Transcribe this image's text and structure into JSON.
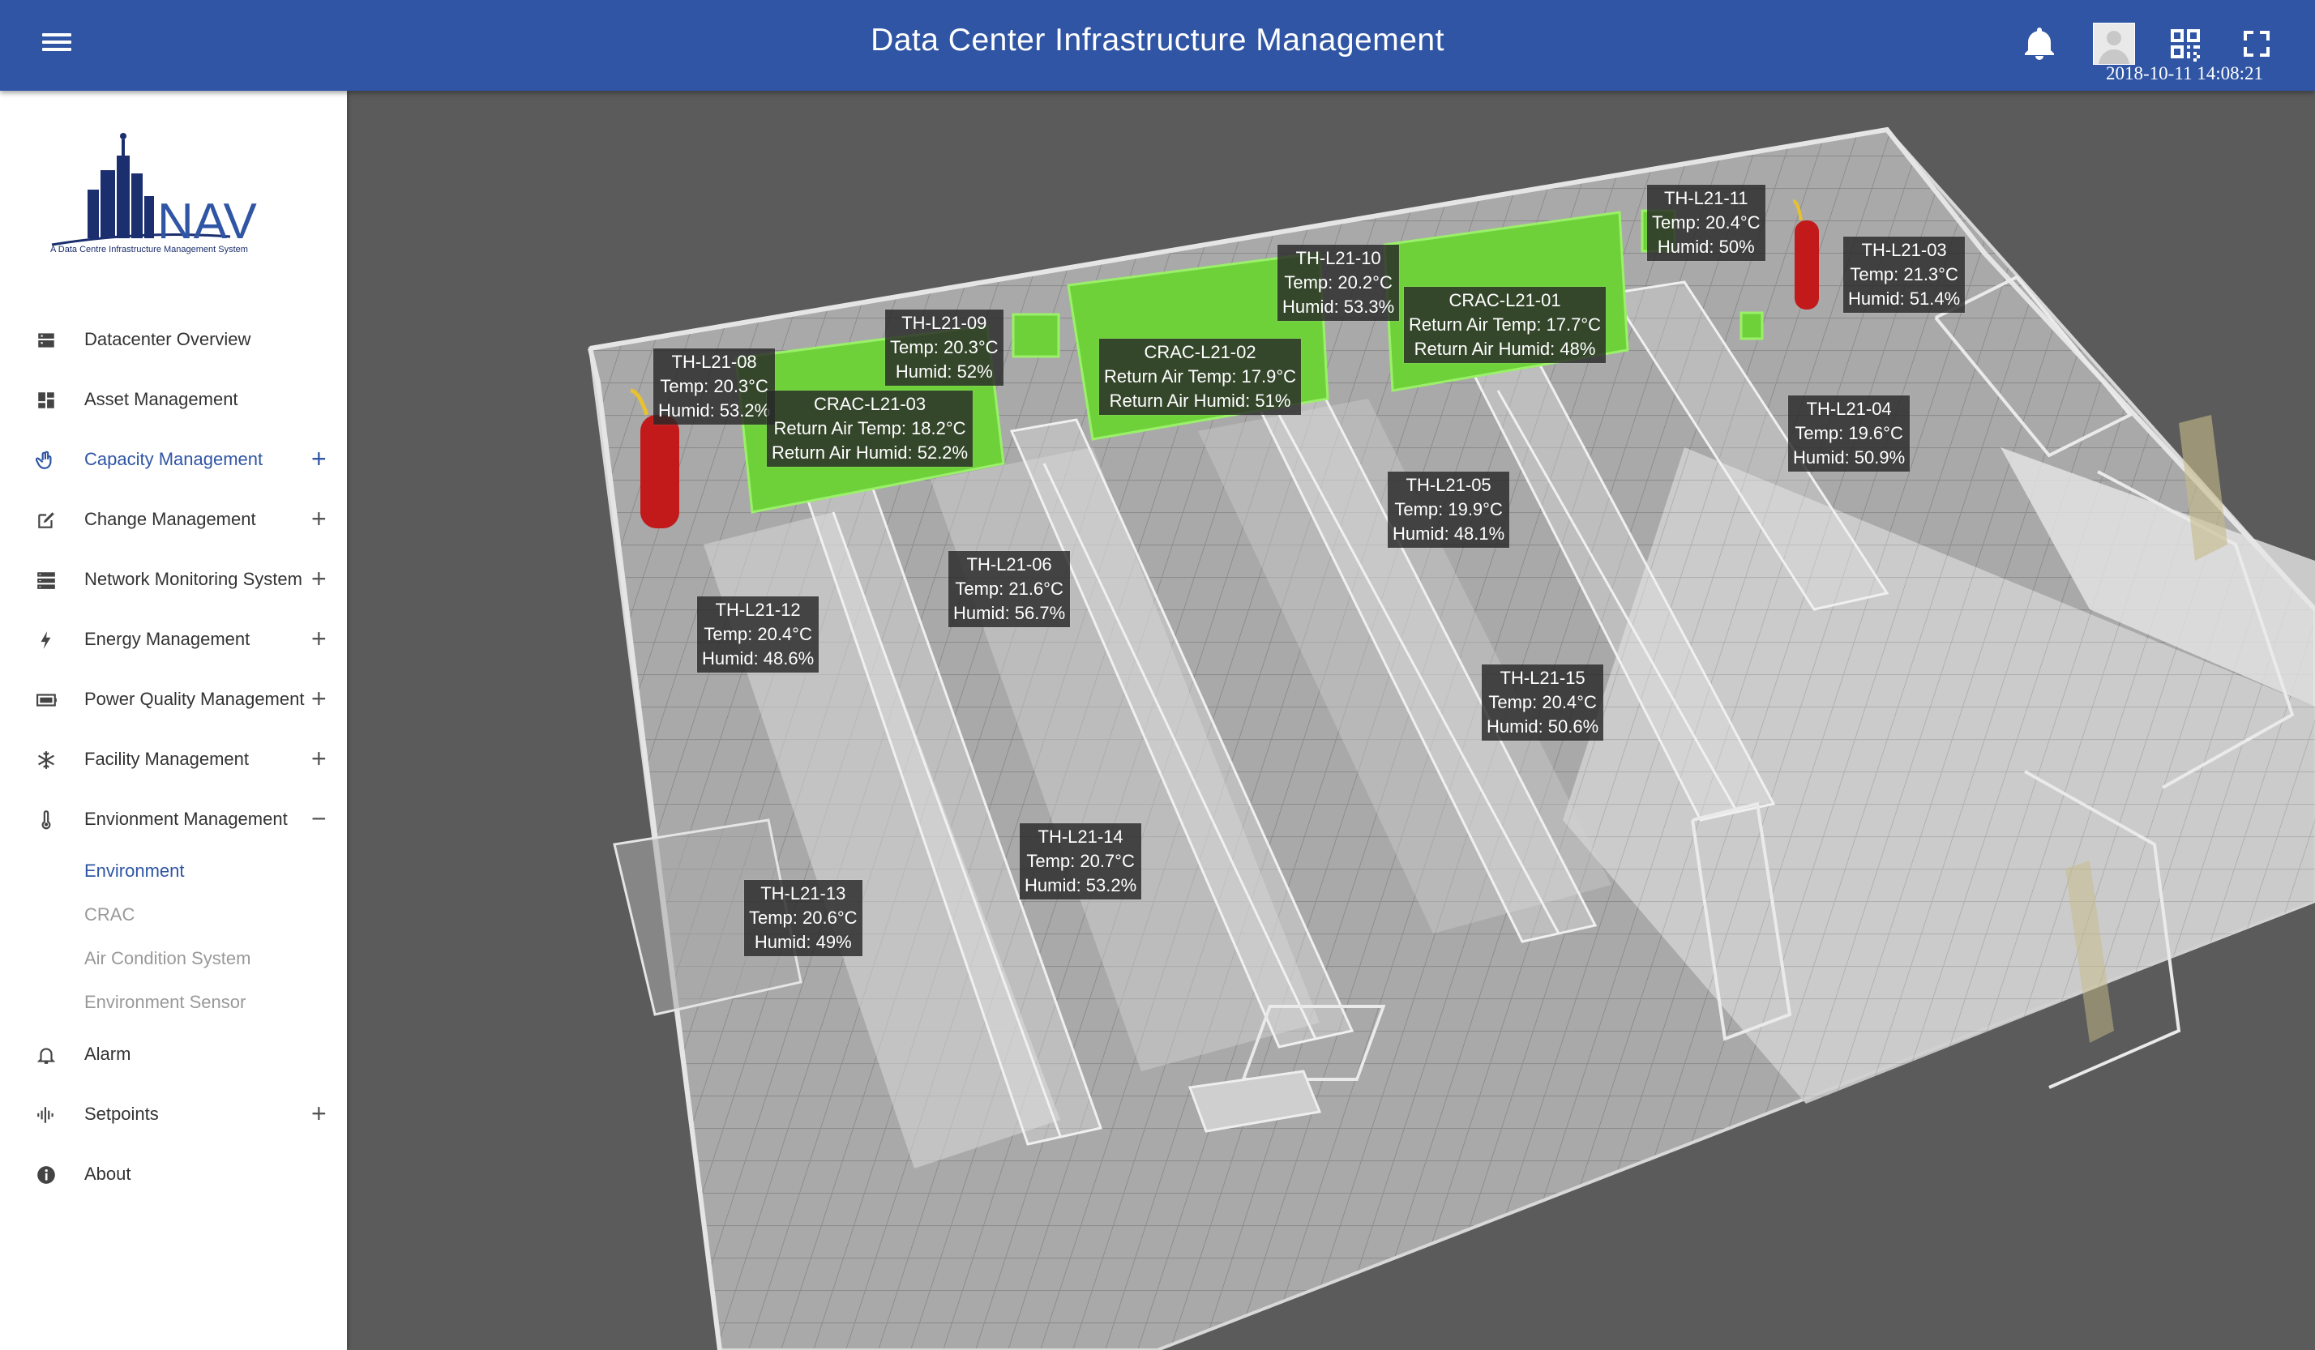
{
  "header": {
    "title": "Data Center Infrastructure Management",
    "datetime": "2018-10-11 14:08:21"
  },
  "icons": {
    "menu": "menu-icon",
    "bell": "bell-icon",
    "avatar": "user-avatar",
    "qr": "qr-code-icon",
    "fullscreen": "fullscreen-icon"
  },
  "colors": {
    "header_bg": "#2f55a4",
    "accent": "#2f55a4",
    "crac_green": "#7be03a",
    "extinguisher_red": "#c21a1a"
  },
  "logo": {
    "text": "NAV",
    "tagline": "A Data Centre Infrastructure Management System"
  },
  "sidebar": {
    "items": [
      {
        "label": "Datacenter Overview",
        "icon": "dashboard-icon",
        "expand": ""
      },
      {
        "label": "Asset Management",
        "icon": "grid-icon",
        "expand": ""
      },
      {
        "label": "Capacity Management",
        "icon": "hand-icon",
        "expand": "+"
      },
      {
        "label": "Change Management",
        "icon": "edit-icon",
        "expand": "+"
      },
      {
        "label": "Network Monitoring System",
        "icon": "server-icon",
        "expand": "+"
      },
      {
        "label": "Energy Management",
        "icon": "bolt-icon",
        "expand": "+"
      },
      {
        "label": "Power Quality Management",
        "icon": "battery-icon",
        "expand": "+"
      },
      {
        "label": "Facility Management",
        "icon": "snowflake-icon",
        "expand": "+"
      },
      {
        "label": "Envionment Management",
        "icon": "thermometer-icon",
        "expand": "−"
      }
    ],
    "subitems": [
      {
        "label": "Environment"
      },
      {
        "label": "CRAC"
      },
      {
        "label": "Air Condition System"
      },
      {
        "label": "Environment Sensor"
      }
    ],
    "items_after": [
      {
        "label": "Alarm",
        "icon": "bell-icon",
        "expand": ""
      },
      {
        "label": "Setpoints",
        "icon": "waveform-icon",
        "expand": "+"
      },
      {
        "label": "About",
        "icon": "info-icon",
        "expand": ""
      }
    ]
  },
  "sensors": [
    {
      "id": "TH-L21-08",
      "temp": "Temp: 20.3°C",
      "humid": "Humid: 53.2%"
    },
    {
      "id": "TH-L21-09",
      "temp": "Temp: 20.3°C",
      "humid": "Humid: 52%"
    },
    {
      "id": "TH-L21-10",
      "temp": "Temp: 20.2°C",
      "humid": "Humid: 53.3%"
    },
    {
      "id": "TH-L21-11",
      "temp": "Temp: 20.4°C",
      "humid": "Humid: 50%"
    },
    {
      "id": "TH-L21-03",
      "temp": "Temp: 21.3°C",
      "humid": "Humid: 51.4%"
    },
    {
      "id": "TH-L21-04",
      "temp": "Temp: 19.6°C",
      "humid": "Humid: 50.9%"
    },
    {
      "id": "TH-L21-05",
      "temp": "Temp: 19.9°C",
      "humid": "Humid: 48.1%"
    },
    {
      "id": "TH-L21-06",
      "temp": "Temp: 21.6°C",
      "humid": "Humid: 56.7%"
    },
    {
      "id": "TH-L21-12",
      "temp": "Temp: 20.4°C",
      "humid": "Humid: 48.6%"
    },
    {
      "id": "TH-L21-15",
      "temp": "Temp: 20.4°C",
      "humid": "Humid: 50.6%"
    },
    {
      "id": "TH-L21-14",
      "temp": "Temp: 20.7°C",
      "humid": "Humid: 53.2%"
    },
    {
      "id": "TH-L21-13",
      "temp": "Temp: 20.6°C",
      "humid": "Humid: 49%"
    }
  ],
  "cracs": [
    {
      "id": "CRAC-L21-03",
      "temp": "Return Air Temp: 18.2°C",
      "humid": "Return Air Humid: 52.2%"
    },
    {
      "id": "CRAC-L21-02",
      "temp": "Return Air Temp: 17.9°C",
      "humid": "Return Air Humid: 51%"
    },
    {
      "id": "CRAC-L21-01",
      "temp": "Return Air Temp: 17.7°C",
      "humid": "Return Air Humid: 48%"
    }
  ]
}
